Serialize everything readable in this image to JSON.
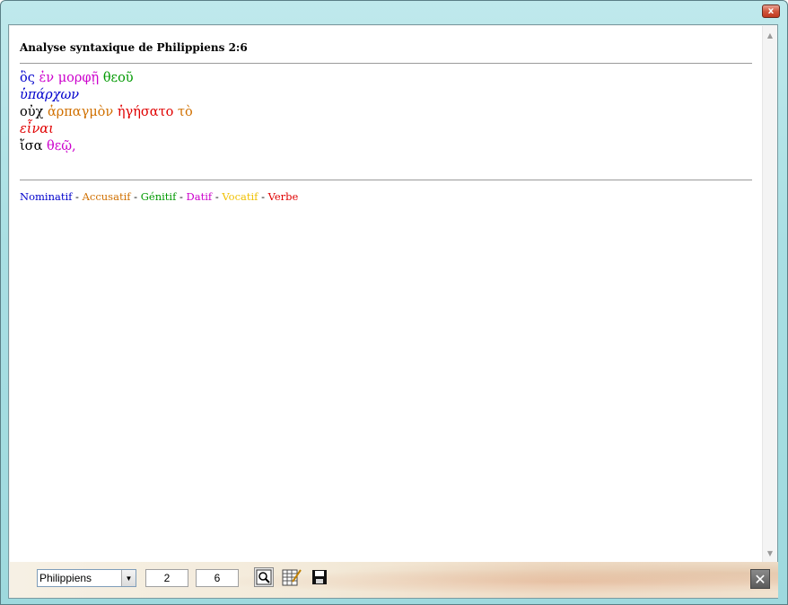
{
  "window": {
    "close_label": "x"
  },
  "page": {
    "title": "Analyse syntaxique de Philippiens 2:6"
  },
  "greek_lines": [
    [
      {
        "text": "ὃς",
        "color": "#0000cc",
        "italic": false
      },
      {
        "text": " ",
        "color": "#000000",
        "italic": false
      },
      {
        "text": "ἐν",
        "color": "#cc00cc",
        "italic": false
      },
      {
        "text": " ",
        "color": "#000000",
        "italic": false
      },
      {
        "text": "μορφῇ",
        "color": "#cc00cc",
        "italic": false
      },
      {
        "text": " ",
        "color": "#000000",
        "italic": false
      },
      {
        "text": "θεοῦ",
        "color": "#009900",
        "italic": false
      }
    ],
    [
      {
        "text": "ὑπάρχων",
        "color": "#0000cc",
        "italic": true
      }
    ],
    [
      {
        "text": "οὐχ",
        "color": "#000000",
        "italic": false
      },
      {
        "text": " ",
        "color": "#000000",
        "italic": false
      },
      {
        "text": "ἁρπαγμὸν",
        "color": "#d07000",
        "italic": false
      },
      {
        "text": " ",
        "color": "#000000",
        "italic": false
      },
      {
        "text": "ἡγήσατο",
        "color": "#e00000",
        "italic": false
      },
      {
        "text": " ",
        "color": "#000000",
        "italic": false
      },
      {
        "text": "τὸ",
        "color": "#d07000",
        "italic": false
      }
    ],
    [
      {
        "text": "εἶναι",
        "color": "#e00000",
        "italic": true
      }
    ],
    [
      {
        "text": "ἴσα",
        "color": "#000000",
        "italic": false
      },
      {
        "text": " ",
        "color": "#000000",
        "italic": false
      },
      {
        "text": "θεῷ,",
        "color": "#cc00cc",
        "italic": false
      }
    ]
  ],
  "legend": {
    "separator": " - ",
    "items": [
      {
        "label": "Nominatif",
        "color": "#0000cc"
      },
      {
        "label": "Accusatif",
        "color": "#d07000"
      },
      {
        "label": "Génitif",
        "color": "#009900"
      },
      {
        "label": "Datif",
        "color": "#cc00cc"
      },
      {
        "label": "Vocatif",
        "color": "#f0c000"
      },
      {
        "label": "Verbe",
        "color": "#e00000"
      }
    ]
  },
  "scrollbar": {
    "up_icon": "▲",
    "down_icon": "▼"
  },
  "toolbar": {
    "book_selected": "Philippiens",
    "chapter": "2",
    "verse": "6",
    "close_icon": "✕",
    "icons": [
      "search-page-icon",
      "edit-grid-icon",
      "save-disk-icon"
    ]
  }
}
